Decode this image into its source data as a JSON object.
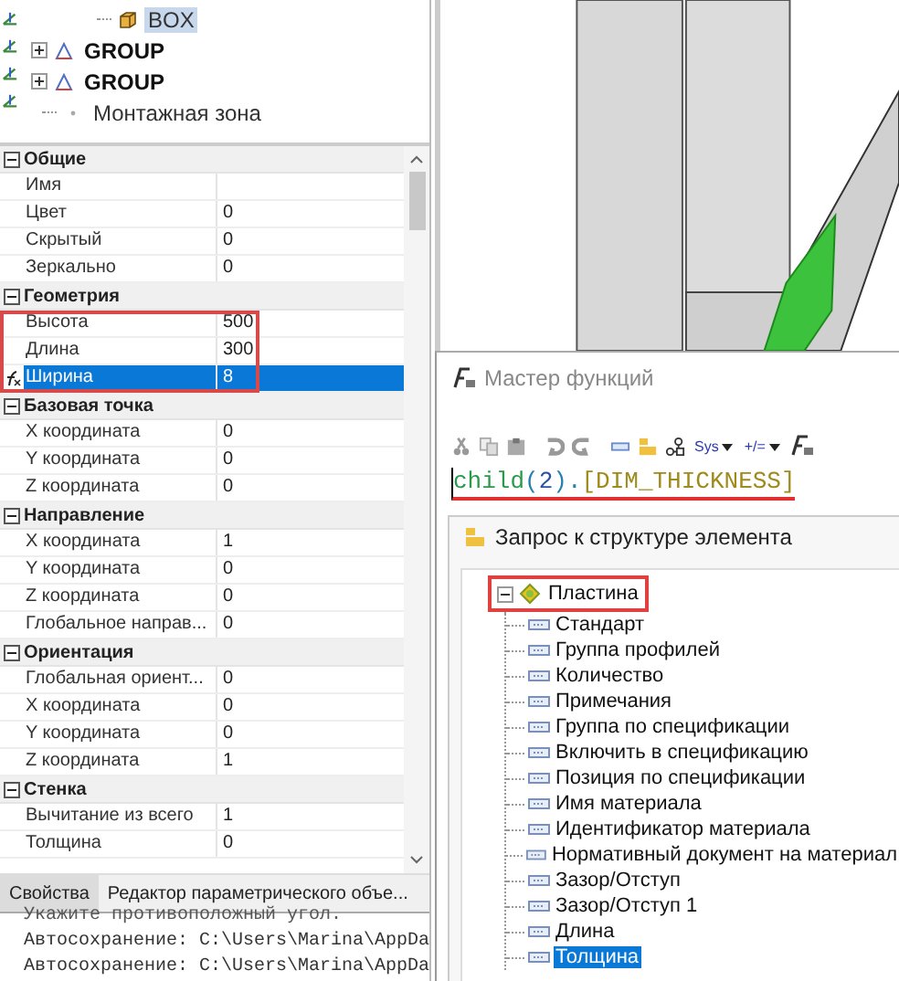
{
  "model_tree": {
    "items": [
      {
        "label": "BOX",
        "kind": "box",
        "selected": true
      },
      {
        "label": "GROUP",
        "kind": "group",
        "expanded": false,
        "selected": false
      },
      {
        "label": "GROUP",
        "kind": "group",
        "expanded": false,
        "selected": false
      },
      {
        "label": "Монтажная зона",
        "kind": "zone",
        "selected": false
      }
    ]
  },
  "properties": {
    "groups": [
      {
        "title": "Общие",
        "expanded": true,
        "highlight": false,
        "rows": [
          {
            "name": "Имя",
            "selected": false
          },
          {
            "name": "Цвет",
            "value": "0",
            "selected": false
          },
          {
            "name": "Скрытый",
            "value": "0",
            "selected": false
          },
          {
            "name": "Зеркально",
            "value": "0",
            "selected": false
          }
        ]
      },
      {
        "title": "Геометрия",
        "expanded": true,
        "highlight": true,
        "rows": [
          {
            "name": "Высота",
            "value": "500",
            "selected": false
          },
          {
            "name": "Длина",
            "value": "300",
            "selected": false
          },
          {
            "name": "Ширина",
            "value": "8",
            "selected": true
          }
        ]
      },
      {
        "title": "Базовая точка",
        "expanded": true,
        "highlight": false,
        "rows": [
          {
            "name": "X координата",
            "value": "0",
            "selected": false
          },
          {
            "name": "Y координата",
            "value": "0",
            "selected": false
          },
          {
            "name": "Z координата",
            "value": "0",
            "selected": false
          }
        ]
      },
      {
        "title": "Направление",
        "expanded": true,
        "highlight": false,
        "rows": [
          {
            "name": "X координата",
            "value": "1",
            "selected": false
          },
          {
            "name": "Y координата",
            "value": "0",
            "selected": false
          },
          {
            "name": "Z координата",
            "value": "0",
            "selected": false
          },
          {
            "name": "Глобальное направ...",
            "value": "0",
            "selected": false
          }
        ]
      },
      {
        "title": "Ориентация",
        "expanded": true,
        "highlight": false,
        "rows": [
          {
            "name": "Глобальная ориент...",
            "value": "0",
            "selected": false
          },
          {
            "name": "X координата",
            "value": "0",
            "selected": false
          },
          {
            "name": "Y координата",
            "value": "0",
            "selected": false
          },
          {
            "name": "Z координата",
            "value": "1",
            "selected": false
          }
        ]
      },
      {
        "title": "Стенка",
        "expanded": true,
        "highlight": false,
        "rows": [
          {
            "name": "Вычитание из всего",
            "value": "1",
            "selected": false
          },
          {
            "name": "Толщина",
            "value": "0",
            "selected": false
          }
        ]
      }
    ]
  },
  "panel_tabs": [
    {
      "label": "Свойства",
      "selected": true
    },
    {
      "label": "Редактор параметрического объе...",
      "selected": false
    }
  ],
  "console": {
    "lines": [
      "Укажите противоположный угол.",
      "Автосохранение: C:\\Users\\Marina\\AppDa",
      "Автосохранение: C:\\Users\\Marina\\AppDa"
    ]
  },
  "function_wizard": {
    "title": "Мастер функций",
    "toolbar": {
      "dropdowns": [
        "Sys",
        "+/="
      ]
    },
    "formula": {
      "underlined": true,
      "tokens": [
        {
          "text": "child",
          "kind": "function"
        },
        {
          "text": "(",
          "kind": "punct"
        },
        {
          "text": "2",
          "kind": "number"
        },
        {
          "text": ").",
          "kind": "punct"
        },
        {
          "text": "[DIM_THICKNESS]",
          "kind": "field"
        }
      ]
    },
    "structure_query": {
      "title": "Запрос к структуре элемента",
      "tree": [
        {
          "label": "Пластина",
          "expanded": true,
          "highlighted": true,
          "selected": false,
          "children": [
            {
              "label": "Стандарт",
              "selected": false
            },
            {
              "label": "Группа профилей",
              "selected": false
            },
            {
              "label": "Количество",
              "selected": false
            },
            {
              "label": "Примечания",
              "selected": false
            },
            {
              "label": "Группа по спецификации",
              "selected": false
            },
            {
              "label": "Включить в спецификацию",
              "selected": false
            },
            {
              "label": "Позиция по спецификации",
              "selected": false
            },
            {
              "label": "Имя материала",
              "selected": false
            },
            {
              "label": "Идентификатор материала",
              "selected": false
            },
            {
              "label": "Нормативный документ на материал",
              "selected": false
            },
            {
              "label": "Зазор/Отступ",
              "selected": false
            },
            {
              "label": "Зазор/Отступ 1",
              "selected": false
            },
            {
              "label": "Длина",
              "selected": false
            },
            {
              "label": "Толщина",
              "selected": true
            }
          ]
        }
      ]
    }
  }
}
